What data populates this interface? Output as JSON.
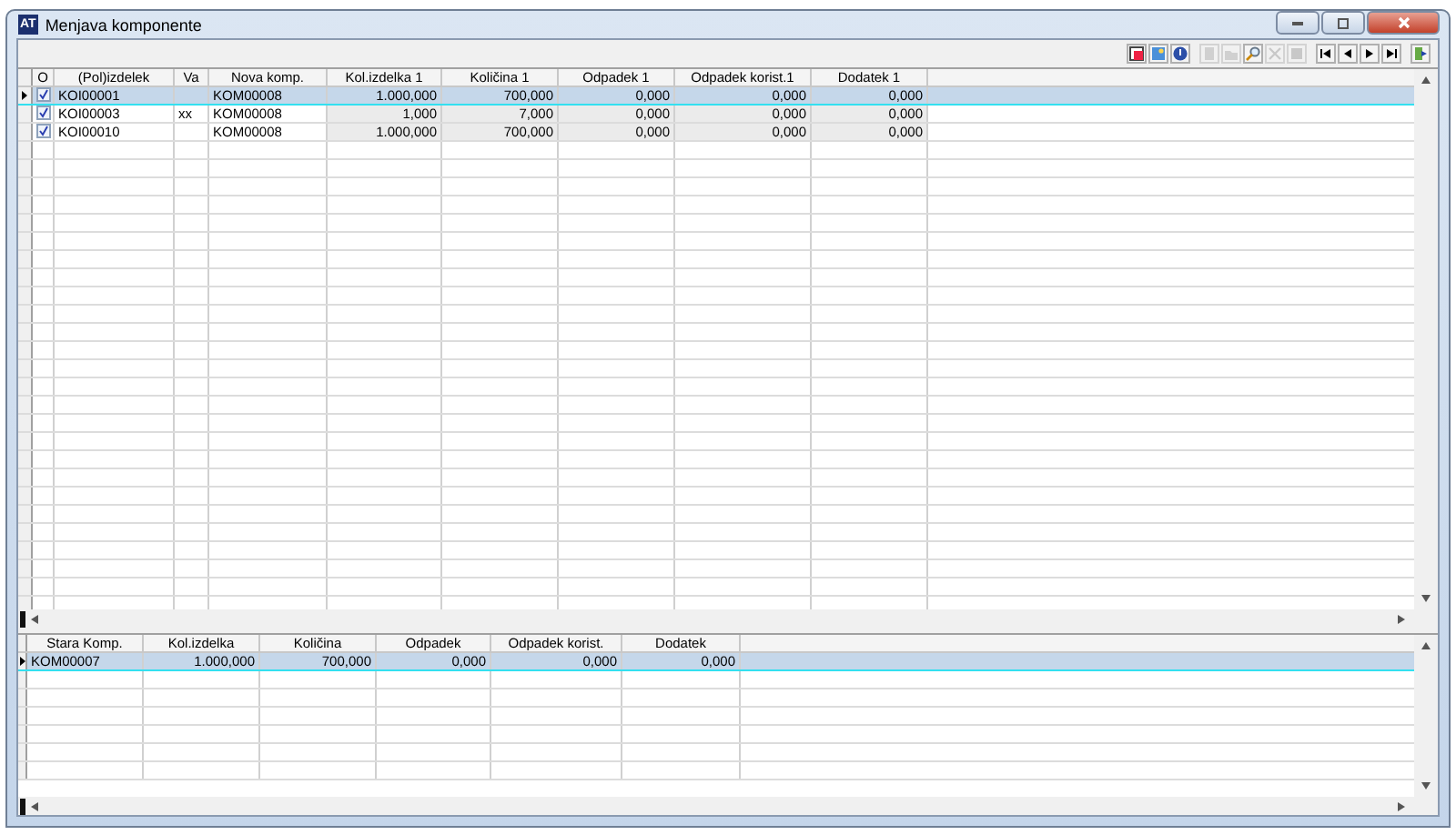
{
  "window": {
    "title": "Menjava komponente",
    "app_badge": "AT"
  },
  "toolbar": [
    {
      "kind": "report",
      "disabled": false
    },
    {
      "kind": "picture",
      "disabled": false
    },
    {
      "kind": "help",
      "disabled": false
    },
    {
      "kind": "new",
      "disabled": true
    },
    {
      "kind": "open",
      "disabled": true
    },
    {
      "kind": "search",
      "disabled": false
    },
    {
      "kind": "delete",
      "disabled": true
    },
    {
      "kind": "save",
      "disabled": true
    },
    {
      "kind": "first",
      "disabled": false
    },
    {
      "kind": "prev",
      "disabled": false
    },
    {
      "kind": "next",
      "disabled": false
    },
    {
      "kind": "last",
      "disabled": false
    },
    {
      "kind": "exit",
      "disabled": false
    }
  ],
  "upper_table": {
    "columns": [
      {
        "label": "O",
        "kind": "check"
      },
      {
        "label": "(Pol)izdelek",
        "kind": "text"
      },
      {
        "label": "Va",
        "kind": "text"
      },
      {
        "label": "Nova komp.",
        "kind": "text"
      },
      {
        "label": "Kol.izdelka 1",
        "kind": "num"
      },
      {
        "label": "Količina 1",
        "kind": "num"
      },
      {
        "label": "Odpadek 1",
        "kind": "num"
      },
      {
        "label": "Odpadek korist.1",
        "kind": "num"
      },
      {
        "label": "Dodatek 1",
        "kind": "num"
      }
    ],
    "rows": [
      {
        "selected": true,
        "checked": true,
        "cells": [
          "",
          "KOI00001",
          "",
          "KOM00008",
          "1.000,000",
          "700,000",
          "0,000",
          "0,000",
          "0,000"
        ]
      },
      {
        "selected": false,
        "checked": true,
        "cells": [
          "",
          "KOI00003",
          "xx",
          "KOM00008",
          "1,000",
          "7,000",
          "0,000",
          "0,000",
          "0,000"
        ]
      },
      {
        "selected": false,
        "checked": true,
        "cells": [
          "",
          "KOI00010",
          "",
          "KOM00008",
          "1.000,000",
          "700,000",
          "0,000",
          "0,000",
          "0,000"
        ]
      }
    ]
  },
  "lower_table": {
    "columns": [
      {
        "label": "Stara Komp.",
        "kind": "text"
      },
      {
        "label": "Kol.izdelka",
        "kind": "num"
      },
      {
        "label": "Količina",
        "kind": "num"
      },
      {
        "label": "Odpadek",
        "kind": "num"
      },
      {
        "label": "Odpadek korist.",
        "kind": "num"
      },
      {
        "label": "Dodatek",
        "kind": "num"
      }
    ],
    "rows": [
      {
        "selected": true,
        "cells": [
          "KOM00007",
          "1.000,000",
          "700,000",
          "0,000",
          "0,000",
          "0,000"
        ]
      }
    ]
  }
}
